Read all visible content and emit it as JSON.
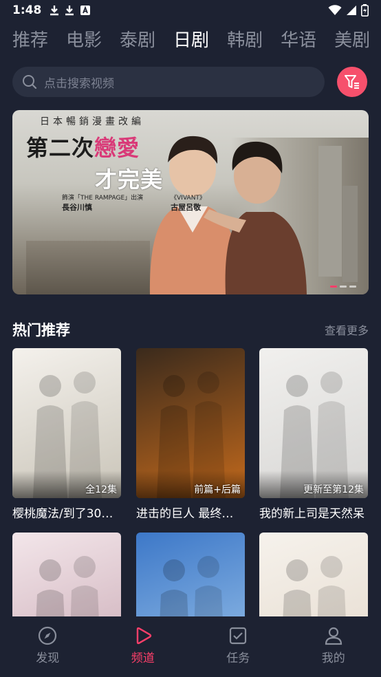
{
  "status": {
    "time": "1:48"
  },
  "tabs": [
    "推荐",
    "电影",
    "泰剧",
    "日剧",
    "韩剧",
    "华语",
    "美剧"
  ],
  "active_tab": 3,
  "search": {
    "placeholder": "点击搜索视频"
  },
  "banner": {
    "subtitle": "日本暢銷漫畫改編",
    "title_part1": "第二次",
    "title_highlight": "戀愛",
    "title_part2": "才完美",
    "cast": [
      {
        "note": "飾演「THE RAMPAGE」出演",
        "name": "長谷川慎"
      },
      {
        "note": "《VIVANT》",
        "name": "古屋呂敬"
      }
    ]
  },
  "section": {
    "title": "热门推荐",
    "more": "查看更多"
  },
  "cards": [
    {
      "name": "樱桃魔法/到了30…",
      "episodes": "全12集",
      "colors": [
        "#f4f1ec",
        "#c9c4b8"
      ]
    },
    {
      "name": "进击的巨人 最终…",
      "episodes": "前篇+后篇",
      "colors": [
        "#3a2a1c",
        "#c46a1c"
      ]
    },
    {
      "name": "我的新上司是天然呆",
      "episodes": "更新至第12集",
      "colors": [
        "#f1f0ee",
        "#d7d6d4"
      ]
    },
    {
      "name": "",
      "episodes": "",
      "colors": [
        "#f3e6ea",
        "#c9a9b4"
      ]
    },
    {
      "name": "",
      "episodes": "",
      "colors": [
        "#3d78c8",
        "#9cc4ea"
      ]
    },
    {
      "name": "",
      "episodes": "",
      "colors": [
        "#f6f2ec",
        "#e4d9cc"
      ]
    }
  ],
  "nav": [
    {
      "label": "发现",
      "icon": "compass-icon"
    },
    {
      "label": "频道",
      "icon": "play-icon"
    },
    {
      "label": "任务",
      "icon": "task-icon"
    },
    {
      "label": "我的",
      "icon": "profile-icon"
    }
  ],
  "active_nav": 1,
  "colors": {
    "accent": "#ff3f6a",
    "background": "#1d2232"
  }
}
